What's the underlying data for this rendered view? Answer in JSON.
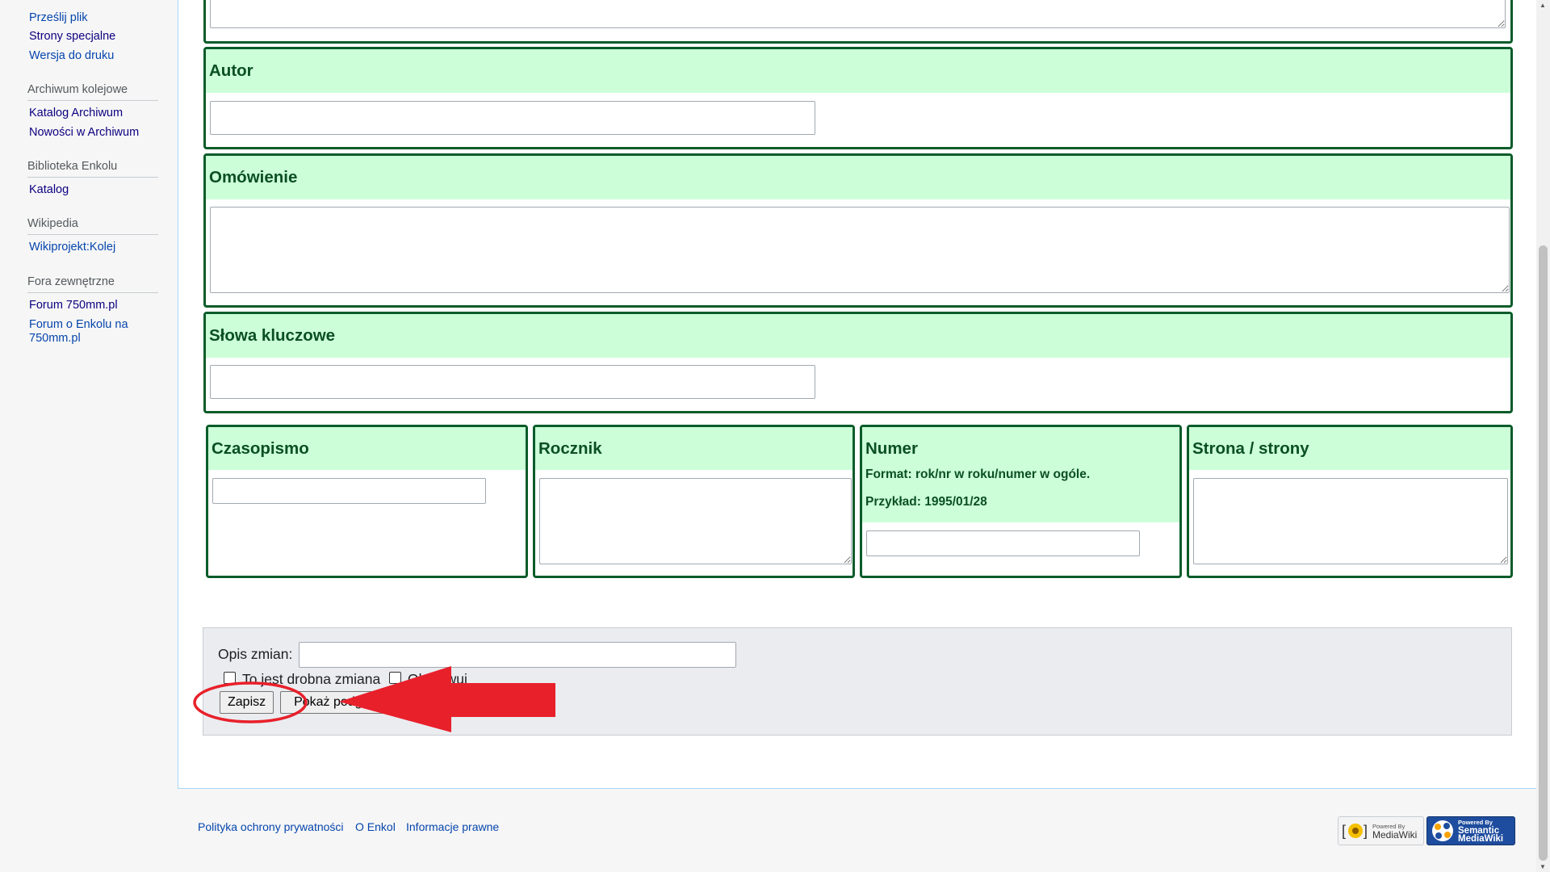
{
  "sidebar": {
    "tools": [
      {
        "label": "Prześlij plik"
      },
      {
        "label": "Strony specjalne"
      },
      {
        "label": "Wersja do druku"
      }
    ],
    "sections": [
      {
        "heading": "Archiwum kolejowe",
        "items": [
          {
            "label": "Katalog Archiwum"
          },
          {
            "label": "Nowości w Archiwum"
          }
        ]
      },
      {
        "heading": "Biblioteka Enkolu",
        "items": [
          {
            "label": "Katalog"
          }
        ]
      },
      {
        "heading": "Wikipedia",
        "items": [
          {
            "label": "Wikiprojekt:Kolej"
          }
        ]
      },
      {
        "heading": "Fora zewnętrzne",
        "items": [
          {
            "label": "Forum 750mm.pl"
          },
          {
            "label": "Forum o Enkolu na 750mm.pl"
          }
        ]
      }
    ]
  },
  "form": {
    "autor": {
      "label": "Autor",
      "value": ""
    },
    "omowienie": {
      "label": "Omówienie",
      "value": ""
    },
    "slowa_kluczowe": {
      "label": "Słowa kluczowe",
      "value": ""
    },
    "czasopismo": {
      "label": "Czasopismo",
      "value": ""
    },
    "rocznik": {
      "label": "Rocznik",
      "value": ""
    },
    "numer": {
      "label": "Numer",
      "note_format": "Format: rok/nr w roku/numer w ogóle.",
      "note_example": "Przykład: 1995/01/28",
      "value": ""
    },
    "strony": {
      "label": "Strona / strony",
      "value": ""
    }
  },
  "edit_options": {
    "summary_label": "Opis zmian:",
    "summary_value": "",
    "minor_edit_label": "To jest drobna zmiana",
    "watch_label": "Obserwuj",
    "save_button": "Zapisz",
    "preview_button": "Pokaż podgląd"
  },
  "annotation": {
    "color": "#e8202a"
  },
  "footer": {
    "links": [
      {
        "label": "Polityka ochrony prywatności"
      },
      {
        "label": "O Enkol"
      },
      {
        "label": "Informacje prawne"
      }
    ],
    "badges": {
      "mediawiki": {
        "top": "Powered By",
        "bottom": "MediaWiki"
      },
      "smw": {
        "top": "Powered By",
        "middle": "Semantic",
        "bottom": "MediaWiki"
      }
    }
  }
}
